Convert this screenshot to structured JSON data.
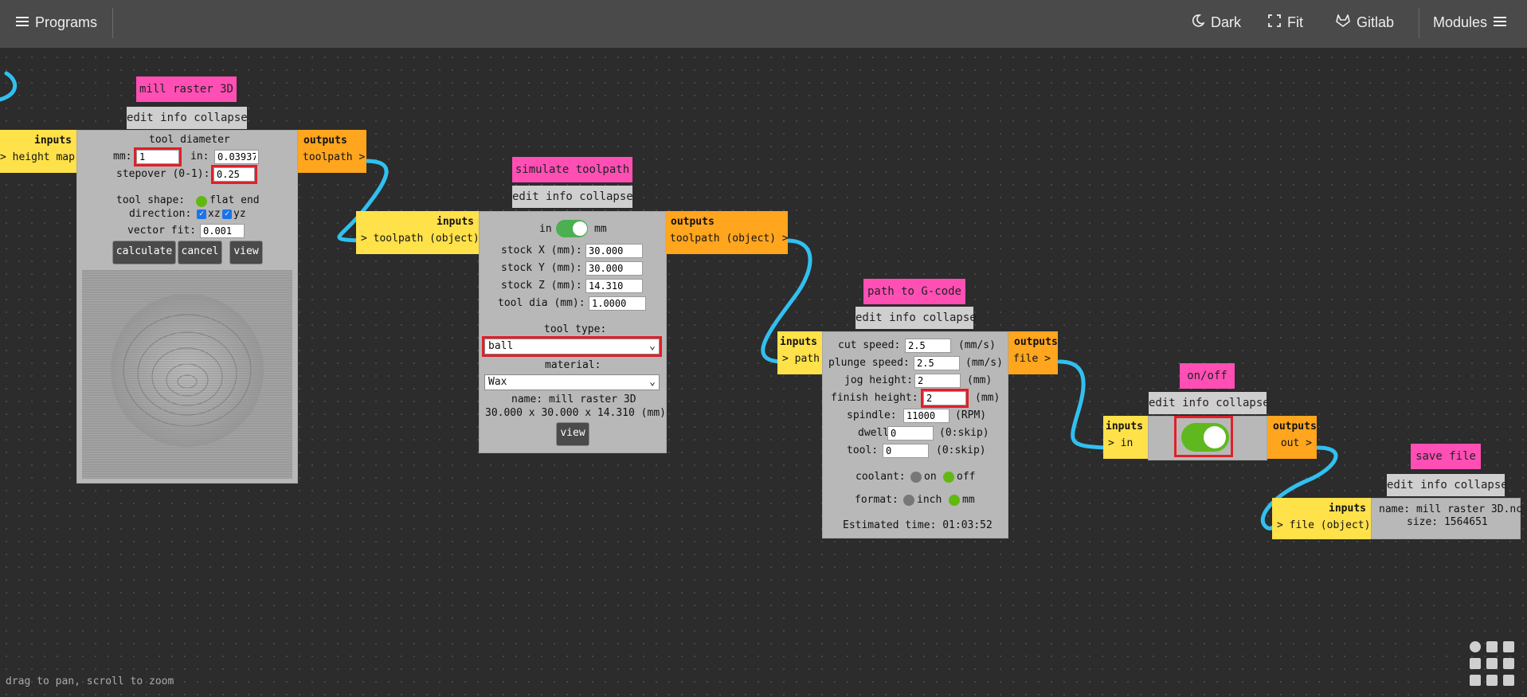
{
  "topbar": {
    "programs": "Programs",
    "dark": "Dark",
    "fit": "Fit",
    "gitlab": "Gitlab",
    "modules": "Modules"
  },
  "common": {
    "bar": "edit info collapse",
    "inputs": "inputs",
    "outputs": "outputs"
  },
  "mill": {
    "title": "mill raster 3D",
    "input_port": "> height map",
    "output_port": "toolpath >",
    "tool_diameter": "tool diameter",
    "mm_label": "mm:",
    "mm_value": "1",
    "in_label": "in:",
    "in_value": "0.03937",
    "stepover_label": "stepover (0-1):",
    "stepover_value": "0.25",
    "tool_shape_label": "tool shape:",
    "tool_shape_value": "flat end",
    "direction_label": "direction:",
    "dir_xz": "xz",
    "dir_yz": "yz",
    "vector_fit_label": "vector fit:",
    "vector_fit_value": "0.001",
    "btn_calculate": "calculate",
    "btn_cancel": "cancel",
    "btn_view": "view"
  },
  "sim": {
    "title": "simulate toolpath",
    "input_port": "> toolpath (object)",
    "output_port": "toolpath (object) >",
    "unit_in": "in",
    "unit_mm": "mm",
    "stock_x_label": "stock X (mm):",
    "stock_x": "30.000",
    "stock_y_label": "stock Y (mm):",
    "stock_y": "30.000",
    "stock_z_label": "stock Z (mm):",
    "stock_z": "14.310",
    "tool_dia_label": "tool dia (mm):",
    "tool_dia": "1.0000",
    "tool_type_label": "tool type:",
    "tool_type_value": "ball",
    "material_label": "material:",
    "material_value": "Wax",
    "name_line": "name: mill raster 3D",
    "dims_line": "30.000 x 30.000 x 14.310 (mm)",
    "btn_view": "view"
  },
  "gcode": {
    "title": "path to G-code",
    "input_port": "> path",
    "output_port": "file >",
    "cut_speed_label": "cut speed:",
    "cut_speed": "2.5",
    "cut_speed_unit": "(mm/s)",
    "plunge_label": "plunge speed:",
    "plunge": "2.5",
    "plunge_unit": "(mm/s)",
    "jog_label": "jog height:",
    "jog": "2",
    "jog_unit": "(mm)",
    "finish_label": "finish height:",
    "finish": "2",
    "finish_unit": "(mm)",
    "spindle_label": "spindle:",
    "spindle": "11000",
    "spindle_unit": "(RPM)",
    "dwell_label": "dwell:",
    "dwell": "0",
    "dwell_unit": "(0:skip)",
    "tool_label": "tool:",
    "tool": "0",
    "tool_unit": "(0:skip)",
    "coolant_label": "coolant:",
    "coolant_on": "on",
    "coolant_off": "off",
    "format_label": "format:",
    "format_inch": "inch",
    "format_mm": "mm",
    "estimated": "Estimated time: 01:03:52"
  },
  "onoff": {
    "title": "on/off",
    "input_port": "> in",
    "output_port": "out >"
  },
  "save": {
    "title": "save file",
    "input_port": "> file (object)",
    "name_line": "name: mill raster 3D.nc",
    "size_line": "size: 1564651"
  },
  "footer": {
    "hint": "drag to pan, scroll to zoom"
  },
  "colors": {
    "title_pink": "#ff4fb5",
    "inputs_yellow": "#ffe14a",
    "outputs_orange": "#ffa51e",
    "wire_blue": "#31c0f0",
    "toggle_green": "#5fb81d",
    "highlight_red": "#e0202a"
  }
}
